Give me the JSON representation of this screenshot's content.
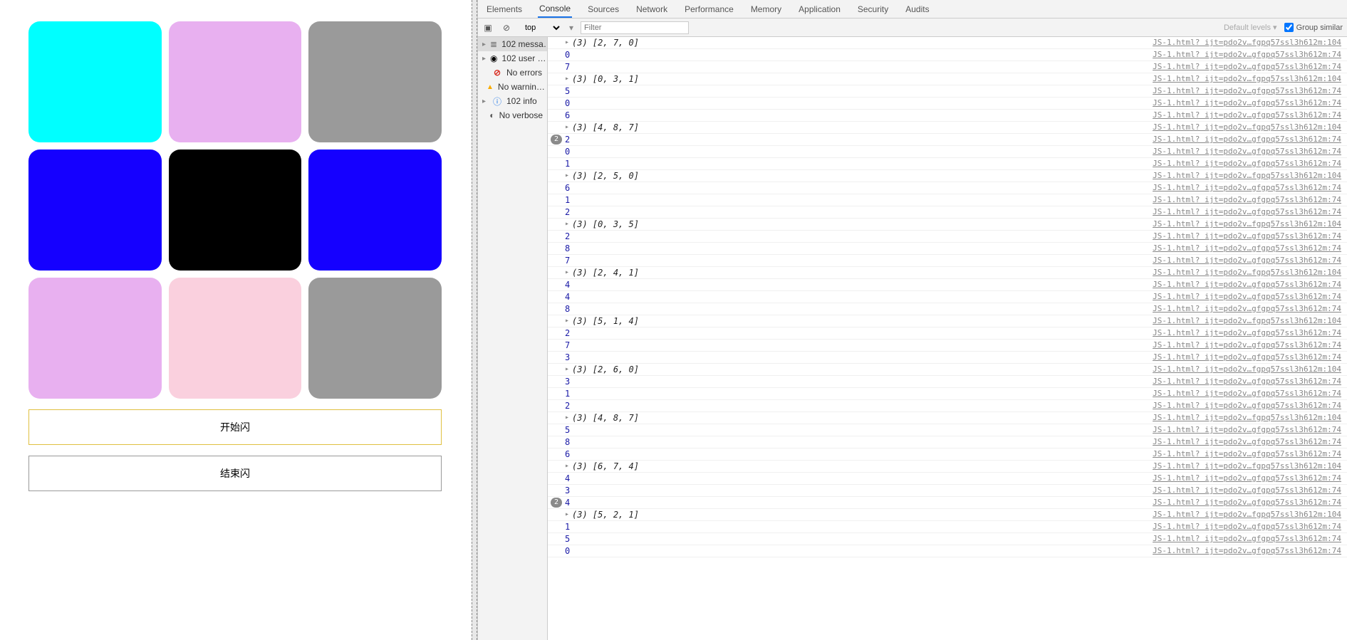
{
  "grid": {
    "tiles": [
      {
        "color": "#00FFFF"
      },
      {
        "color": "#E8B0F0"
      },
      {
        "color": "#9A9A9A"
      },
      {
        "color": "#1500FF"
      },
      {
        "color": "#000000"
      },
      {
        "color": "#1500FF"
      },
      {
        "color": "#E8B0F0"
      },
      {
        "color": "#FAD0DE"
      },
      {
        "color": "#9A9A9A"
      }
    ]
  },
  "buttons": {
    "start_label": "开始闪",
    "end_label": "结束闪"
  },
  "devtools": {
    "tabs": [
      "Elements",
      "Console",
      "Sources",
      "Network",
      "Performance",
      "Memory",
      "Application",
      "Security",
      "Audits"
    ],
    "active_tab": 1,
    "toolbar": {
      "context": "top",
      "filter_placeholder": "Filter",
      "levels_label": "Default levels ▾",
      "group_label": "Group similar"
    },
    "sidebar": {
      "items": [
        {
          "icon": "msg",
          "label": "102 messa…",
          "caret": true,
          "selected": true
        },
        {
          "icon": "user",
          "label": "102 user …",
          "caret": true
        },
        {
          "icon": "err",
          "label": "No errors"
        },
        {
          "icon": "warn",
          "label": "No warnin…"
        },
        {
          "icon": "info",
          "label": "102 info",
          "caret": true
        },
        {
          "icon": "verbose",
          "label": "No verbose"
        }
      ]
    },
    "source_link_arr": "JS-1.html? ijt=pdo2v…fgpq57ssl3h612m:104",
    "source_link_num": "JS-1.html? ijt=pdo2v…gfgpq57ssl3h612m:74",
    "logs": [
      {
        "type": "arr",
        "len": 3,
        "vals": [
          2,
          7,
          0
        ]
      },
      {
        "type": "num",
        "val": 0
      },
      {
        "type": "num",
        "val": 7
      },
      {
        "type": "arr",
        "len": 3,
        "vals": [
          0,
          3,
          1
        ]
      },
      {
        "type": "num",
        "val": 5
      },
      {
        "type": "num",
        "val": 0
      },
      {
        "type": "num",
        "val": 6
      },
      {
        "type": "arr",
        "len": 3,
        "vals": [
          4,
          8,
          7
        ]
      },
      {
        "type": "num",
        "val": 2,
        "badge": 2
      },
      {
        "type": "num",
        "val": 0
      },
      {
        "type": "num",
        "val": 1
      },
      {
        "type": "arr",
        "len": 3,
        "vals": [
          2,
          5,
          0
        ]
      },
      {
        "type": "num",
        "val": 6
      },
      {
        "type": "num",
        "val": 1
      },
      {
        "type": "num",
        "val": 2
      },
      {
        "type": "arr",
        "len": 3,
        "vals": [
          0,
          3,
          5
        ]
      },
      {
        "type": "num",
        "val": 2
      },
      {
        "type": "num",
        "val": 8
      },
      {
        "type": "num",
        "val": 7
      },
      {
        "type": "arr",
        "len": 3,
        "vals": [
          2,
          4,
          1
        ]
      },
      {
        "type": "num",
        "val": 4
      },
      {
        "type": "num",
        "val": 4
      },
      {
        "type": "num",
        "val": 8
      },
      {
        "type": "arr",
        "len": 3,
        "vals": [
          5,
          1,
          4
        ]
      },
      {
        "type": "num",
        "val": 2
      },
      {
        "type": "num",
        "val": 7
      },
      {
        "type": "num",
        "val": 3
      },
      {
        "type": "arr",
        "len": 3,
        "vals": [
          2,
          6,
          0
        ]
      },
      {
        "type": "num",
        "val": 3
      },
      {
        "type": "num",
        "val": 1
      },
      {
        "type": "num",
        "val": 2
      },
      {
        "type": "arr",
        "len": 3,
        "vals": [
          4,
          8,
          7
        ]
      },
      {
        "type": "num",
        "val": 5
      },
      {
        "type": "num",
        "val": 8
      },
      {
        "type": "num",
        "val": 6
      },
      {
        "type": "arr",
        "len": 3,
        "vals": [
          6,
          7,
          4
        ]
      },
      {
        "type": "num",
        "val": 4
      },
      {
        "type": "num",
        "val": 3
      },
      {
        "type": "num",
        "val": 4,
        "badge": 2
      },
      {
        "type": "arr",
        "len": 3,
        "vals": [
          5,
          2,
          1
        ]
      },
      {
        "type": "num",
        "val": 1
      },
      {
        "type": "num",
        "val": 5
      },
      {
        "type": "num",
        "val": 0
      }
    ]
  }
}
